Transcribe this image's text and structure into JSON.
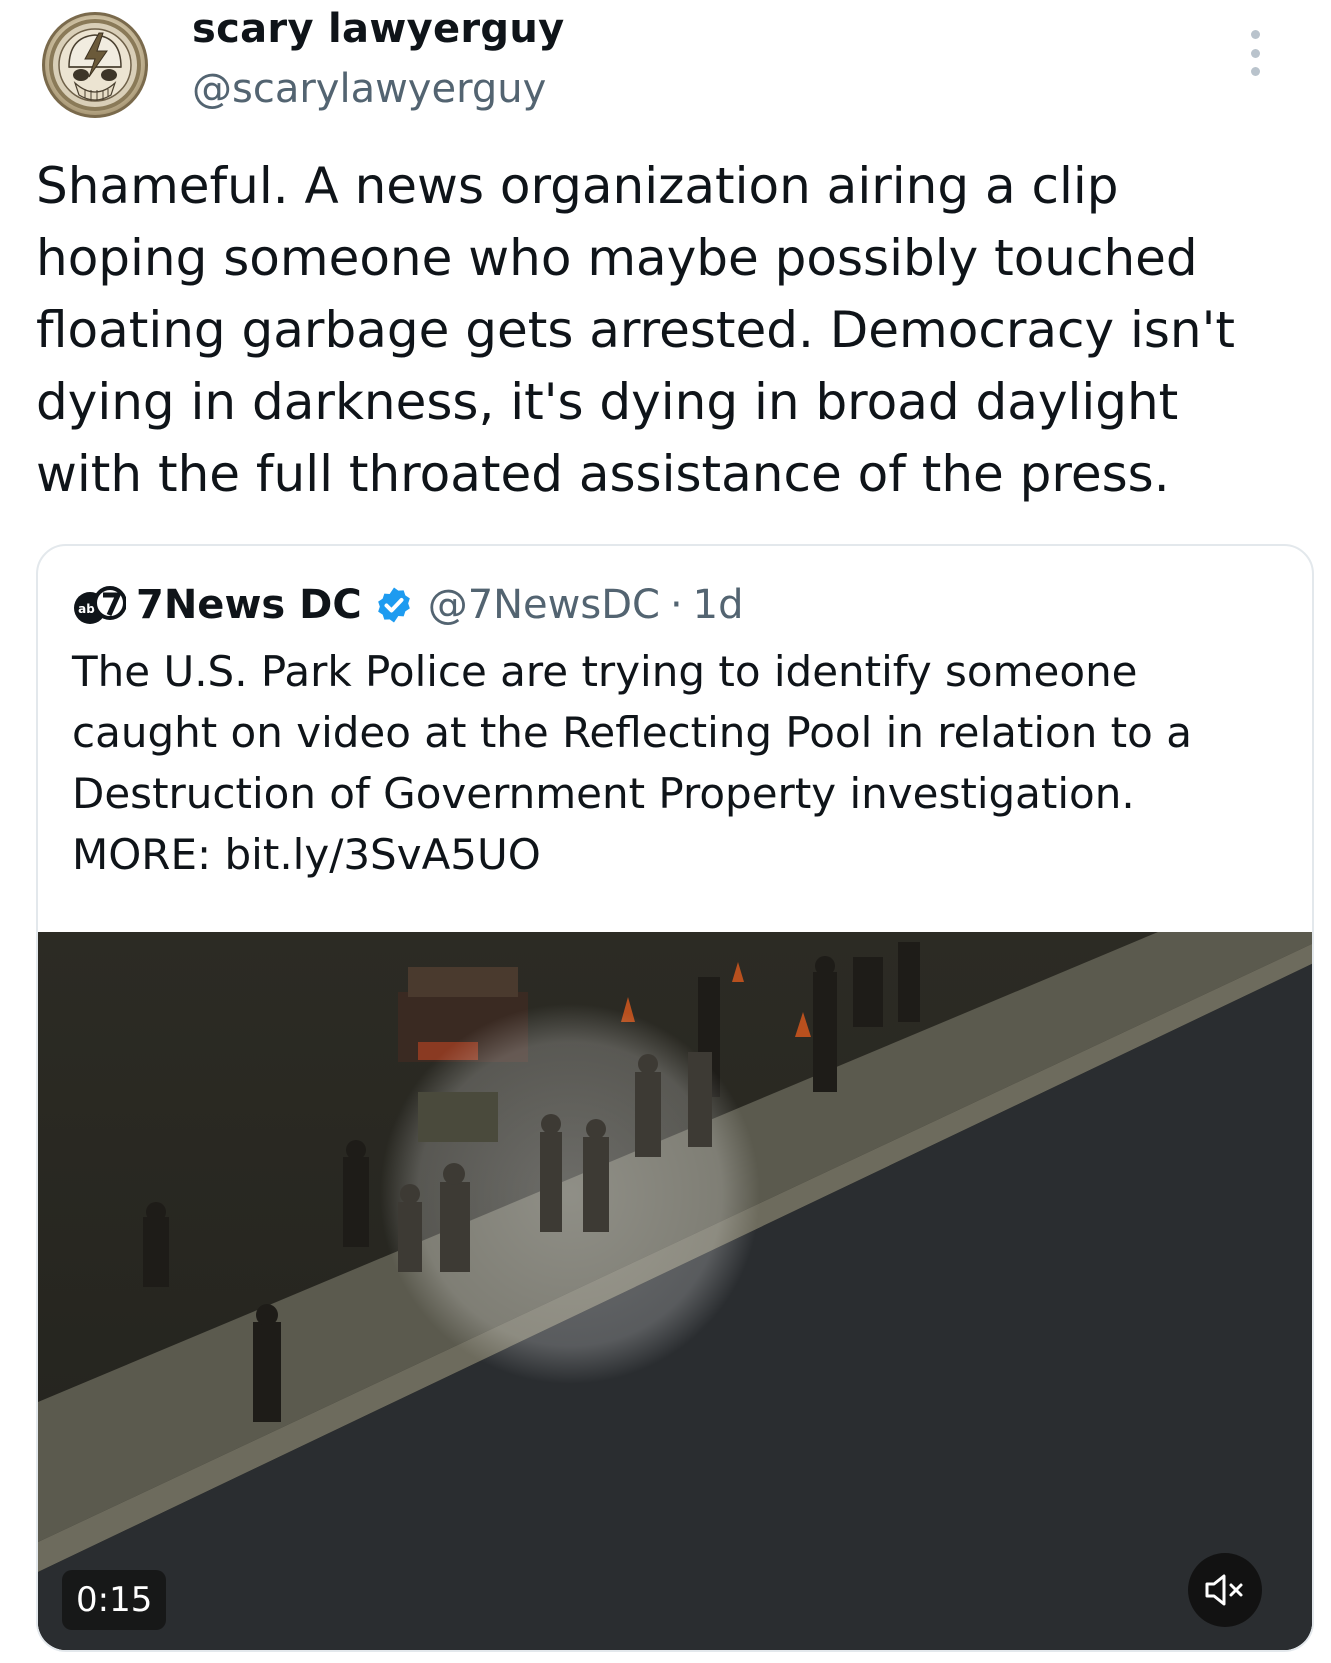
{
  "author": {
    "display_name": "scary lawyerguy",
    "handle": "@scarylawyerguy",
    "avatar_icon": "steal-your-face-skull-icon"
  },
  "tweet": {
    "text": "Shameful. A news organization airing a clip\nhoping someone who maybe possibly touched\nfloating garbage gets arrested. Democracy isn't\ndying in darkness, it's dying in broad daylight\nwith the full throated assistance of the press."
  },
  "quoted": {
    "logo_icon": "abc7-logo-icon",
    "logo_text": "abc",
    "display_name": "7News DC",
    "verified_icon": "verified-badge-icon",
    "handle": "@7NewsDC",
    "separator": "·",
    "time": "1d",
    "text": "The U.S. Park Police are trying to identify someone\ncaught on video at the Reflecting Pool in relation to a\nDestruction of Government Property investigation.\nMORE: bit.ly/3SvA5UO",
    "video": {
      "duration": "0:15",
      "muted": true,
      "mute_icon": "speaker-muted-icon"
    }
  },
  "colors": {
    "text_primary": "#0f1419",
    "text_secondary": "#536471",
    "verified_blue": "#1d9bf0",
    "card_border": "#e3e8ec"
  }
}
